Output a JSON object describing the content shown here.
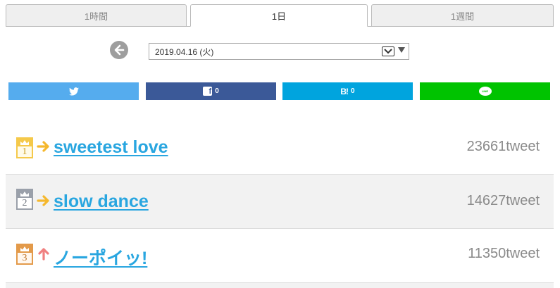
{
  "tabs": [
    {
      "label": "1時間",
      "active": false
    },
    {
      "label": "1日",
      "active": true
    },
    {
      "label": "1週間",
      "active": false
    }
  ],
  "date_select": {
    "selected": "2019.04.16 (火)"
  },
  "share": {
    "twitter": {
      "icon": "twitter-bird-icon"
    },
    "facebook": {
      "count": "0",
      "icon_text": "f"
    },
    "hatena": {
      "count": "0",
      "icon_text": "B!"
    },
    "line": {
      "icon_text": "LINE"
    }
  },
  "ranking": [
    {
      "rank": "1",
      "trend": "flat",
      "title": "sweetest love",
      "count": "23661tweet"
    },
    {
      "rank": "2",
      "trend": "flat",
      "title": "slow dance",
      "count": "14627tweet"
    },
    {
      "rank": "3",
      "trend": "up",
      "title": "ノーポイッ!",
      "count": "11350tweet"
    }
  ],
  "colors": {
    "link": "#29a6e0",
    "twitter": "#55acee",
    "facebook": "#3b5998",
    "hatena": "#00a4de",
    "line": "#00c300",
    "trend_flat": "#f5b82e",
    "trend_up": "#f08080"
  }
}
